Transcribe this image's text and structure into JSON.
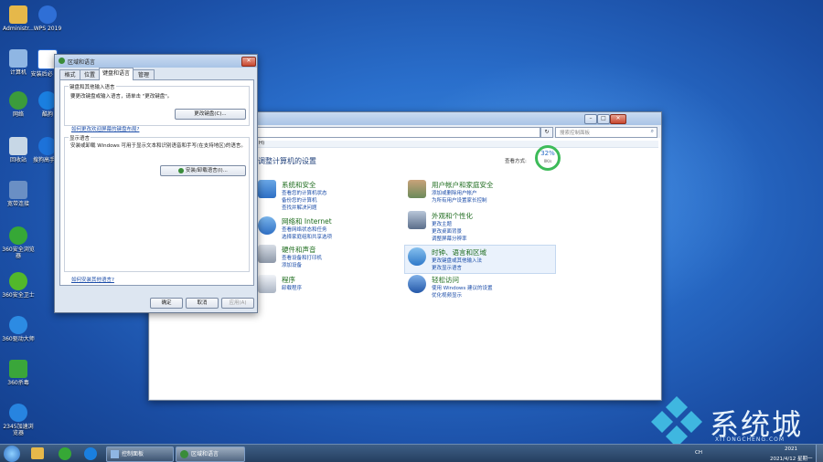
{
  "desktop": {
    "icons": [
      {
        "label": "Administr..."
      },
      {
        "label": "WPS 2019"
      },
      {
        "label": "计算机"
      },
      {
        "label": "安装后必 doc"
      },
      {
        "label": "网络"
      },
      {
        "label": "酷狗"
      },
      {
        "label": "回收站"
      },
      {
        "label": "搜狗高手 器"
      },
      {
        "label": "宽带连接"
      },
      {
        "label": "360安全浏览 器"
      },
      {
        "label": "360安全卫士"
      },
      {
        "label": "360驱动大师"
      },
      {
        "label": "360杀毒"
      },
      {
        "label": "2345加速浏 览器"
      }
    ]
  },
  "control_panel": {
    "heading": "调整计算机的设置",
    "view_label": "查看方式:",
    "search_placeholder": "搜索控制面板",
    "breadcrumb_fragment": "H)",
    "perf": {
      "percent": "32%",
      "rate": "0K/s"
    },
    "categories": [
      {
        "title": "系统和安全",
        "links": [
          "查看您的计算机状态",
          "备份您的计算机",
          "查找并解决问题"
        ]
      },
      {
        "title": "网络和 Internet",
        "links": [
          "查看网络状态和任务",
          "选择家庭组和共享选项"
        ]
      },
      {
        "title": "硬件和声音",
        "links": [
          "查看设备和打印机",
          "添加设备"
        ]
      },
      {
        "title": "程序",
        "links": [
          "卸载程序"
        ]
      },
      {
        "title": "用户帐户和家庭安全",
        "links": [
          "添加或删除用户帐户",
          "为所有用户设置家长控制"
        ]
      },
      {
        "title": "外观和个性化",
        "links": [
          "更改主题",
          "更改桌面背景",
          "调整屏幕分辨率"
        ]
      },
      {
        "title": "时钟、语言和区域",
        "links": [
          "更改键盘或其他输入法",
          "更改显示语言"
        ]
      },
      {
        "title": "轻松访问",
        "links": [
          "使用 Windows 建议的设置",
          "优化视频显示"
        ]
      }
    ]
  },
  "dialog": {
    "title": "区域和语言",
    "tabs": [
      "格式",
      "位置",
      "键盘和语言",
      "管理"
    ],
    "keyboard_group": {
      "title": "键盘和其他输入语言",
      "desc": "要更改键盘或输入语言，请单击 \"更改键盘\"。",
      "button": "更改键盘(C)...",
      "link": "如何更改欢迎屏幕的键盘布局?"
    },
    "display_group": {
      "title": "显示语言",
      "desc": "安装或卸载 Windows 可用于显示文本和识别语音和手写(在支持地区)的语言。",
      "button": "安装/卸载语言(I)..."
    },
    "bottom_link": "如何安装其他语言?",
    "ok": "确定",
    "cancel": "取消",
    "apply": "应用(A)"
  },
  "taskbar": {
    "tasks": [
      "控制面板",
      "区域和语言"
    ],
    "tray_text": "CH",
    "time": "2021",
    "date": "2021/4/12 星期一"
  },
  "watermark": {
    "brand": "系统城",
    "url": "XITONGCHENG.COM"
  }
}
